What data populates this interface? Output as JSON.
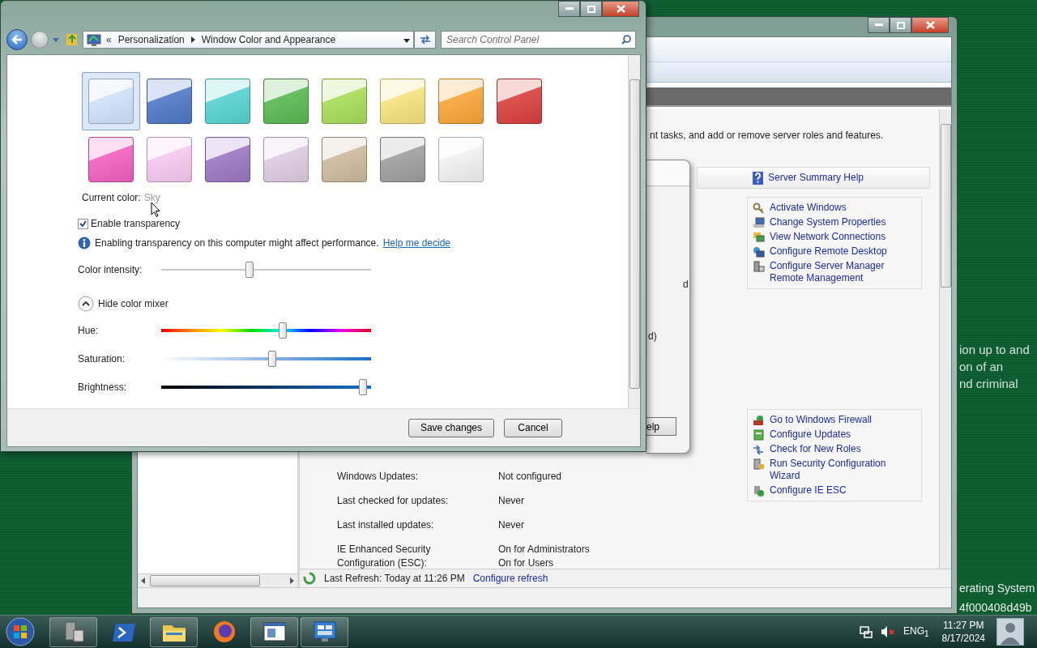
{
  "desktop": {
    "notice_lines": [
      "ion up to and",
      "on of an",
      "nd criminal"
    ],
    "build_lines": [
      "erating System",
      "4f000408d49b"
    ]
  },
  "server_manager": {
    "description": "nt tasks, and add or remove server roles and features.",
    "help_link": "Server Summary Help",
    "task_groups": [
      [
        {
          "kind": "key",
          "label": "Activate Windows"
        },
        {
          "kind": "computer",
          "label": "Change System Properties"
        },
        {
          "kind": "network",
          "label": "View Network Connections"
        },
        {
          "kind": "remote",
          "label": "Configure Remote Desktop"
        },
        {
          "kind": "server",
          "label": "Configure Server Manager Remote Management"
        }
      ],
      [
        {
          "kind": "firewall",
          "label": "Go to Windows Firewall"
        },
        {
          "kind": "updates",
          "label": "Configure Updates"
        },
        {
          "kind": "roles",
          "label": "Check for New Roles"
        },
        {
          "kind": "security",
          "label": "Run Security Configuration Wizard"
        },
        {
          "kind": "ie",
          "label": "Configure IE ESC"
        }
      ]
    ],
    "info_rows": [
      {
        "label": "Windows Updates:",
        "values": [
          "Not configured"
        ]
      },
      {
        "label": "Last checked for updates:",
        "values": [
          "Never"
        ]
      },
      {
        "label": "Last installed updates:",
        "values": [
          "Never"
        ]
      },
      {
        "label": "IE Enhanced Security Configuration (ESC):",
        "values": [
          "On for Administrators",
          "On for Users"
        ]
      }
    ],
    "status": {
      "text": "Last Refresh: Today at 11:26 PM",
      "link": "Configure refresh"
    }
  },
  "dialog": {
    "fragments": [
      "d",
      "d)"
    ],
    "button": "elp"
  },
  "personalization": {
    "back_chevron": "«",
    "breadcrumb": [
      "Personalization",
      "Window Color and Appearance"
    ],
    "search": {
      "placeholder": "Search Control Panel"
    },
    "swatches": [
      {
        "color": "#cfe2fa",
        "selected": true
      },
      {
        "color": "#4d78c8",
        "selected": false
      },
      {
        "color": "#55d2d0",
        "selected": false
      },
      {
        "color": "#58b950",
        "selected": false
      },
      {
        "color": "#a8dc58",
        "selected": false
      },
      {
        "color": "#f5e27c",
        "selected": false
      },
      {
        "color": "#f7a537",
        "selected": false
      },
      {
        "color": "#d8403e",
        "selected": false
      },
      {
        "color": "#f060c0",
        "selected": false
      },
      {
        "color": "#f6c8f0",
        "selected": false
      },
      {
        "color": "#9b76c4",
        "selected": false
      },
      {
        "color": "#dccbe0",
        "selected": false
      },
      {
        "color": "#cbbb9c",
        "selected": false
      },
      {
        "color": "#9e9e9e",
        "selected": false
      },
      {
        "color": "#f1f1f1",
        "selected": false
      }
    ],
    "current_color_label": "Current color:",
    "current_color": "Sky",
    "transparency": {
      "label": "Enable transparency",
      "checked": true
    },
    "info": {
      "text": "Enabling transparency on this computer might affect performance.",
      "link": "Help me decide"
    },
    "intensity": {
      "label": "Color intensity:",
      "level": 0.42
    },
    "mixer": {
      "label": "Hide color mixer",
      "expanded": true
    },
    "sliders": [
      {
        "kind": "hue",
        "label": "Hue:",
        "level": 0.58
      },
      {
        "kind": "saturation",
        "label": "Saturation:",
        "level": 0.53
      },
      {
        "kind": "brightness",
        "label": "Brightness:",
        "level": 0.96
      }
    ],
    "buttons": [
      "Save changes",
      "Cancel"
    ]
  },
  "taskbar": {
    "apps": [
      {
        "kind": "server-manager",
        "running": true
      },
      {
        "kind": "powershell",
        "running": false
      },
      {
        "kind": "explorer",
        "running": true
      },
      {
        "kind": "firefox",
        "running": false
      },
      {
        "kind": "document",
        "running": true
      },
      {
        "kind": "control-panel",
        "running": true
      }
    ],
    "language": "ENG$_{1}$",
    "time": "11:27 PM",
    "date": "8/17/2024"
  }
}
